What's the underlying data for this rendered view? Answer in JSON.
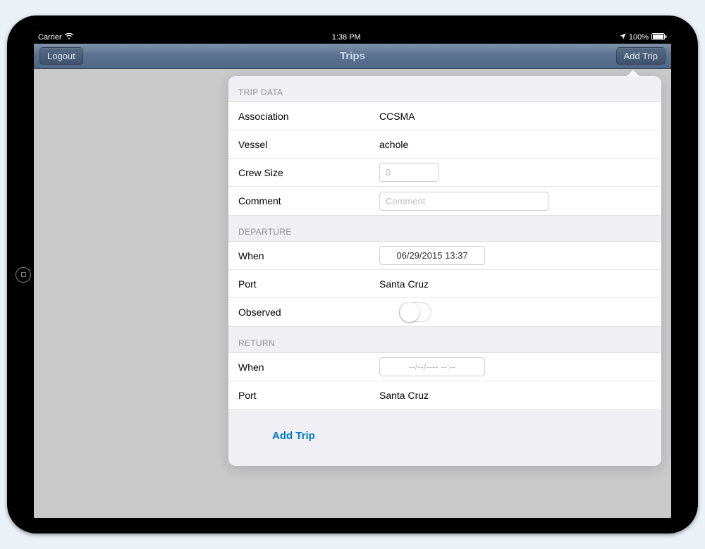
{
  "status": {
    "carrier": "Carrier",
    "time": "1:38 PM",
    "battery": "100%"
  },
  "nav": {
    "logout": "Logout",
    "title": "Trips",
    "addTrip": "Add Trip"
  },
  "sections": {
    "tripData": "TRIP DATA",
    "departure": "DEPARTURE",
    "return": "RETURN"
  },
  "tripData": {
    "associationLabel": "Association",
    "associationValue": "CCSMA",
    "vesselLabel": "Vessel",
    "vesselValue": "achole",
    "crewSizeLabel": "Crew Size",
    "crewSizePlaceholder": "0",
    "commentLabel": "Comment",
    "commentPlaceholder": "Comment"
  },
  "departure": {
    "whenLabel": "When",
    "whenValue": "06/29/2015 13:37",
    "portLabel": "Port",
    "portValue": "Santa Cruz",
    "observedLabel": "Observed"
  },
  "return": {
    "whenLabel": "When",
    "whenPlaceholder": "--/--/---- --:--",
    "portLabel": "Port",
    "portValue": "Santa Cruz"
  },
  "actions": {
    "addTrip": "Add Trip"
  }
}
